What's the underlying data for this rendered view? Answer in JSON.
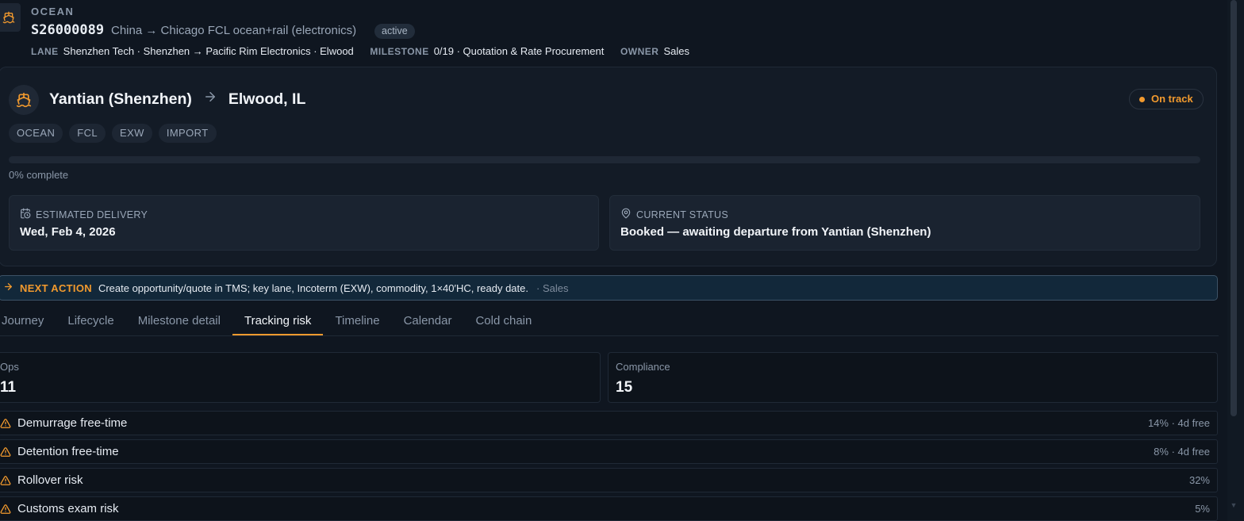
{
  "header": {
    "mode": "OCEAN",
    "shipment_id": "S26000089",
    "description": "China → Chicago FCL ocean+rail (electronics)",
    "status_badge": "active",
    "lane_label": "LANE",
    "lane_value": "Shenzhen Tech · Shenzhen → Pacific Rim Electronics · Elwood",
    "milestone_label": "MILESTONE",
    "milestone_value": "0/19 · Quotation & Rate Procurement",
    "owner_label": "OWNER",
    "owner_value": "Sales",
    "icon": "ship-icon"
  },
  "route": {
    "origin": "Yantian (Shenzhen)",
    "destination": "Elwood, IL",
    "status": "On track",
    "status_color": "#f29a2e",
    "tags": [
      "OCEAN",
      "FCL",
      "EXW",
      "IMPORT"
    ],
    "progress_fraction": 0,
    "progress_text": "0% complete",
    "estimated_delivery_label": "ESTIMATED DELIVERY",
    "estimated_delivery_value": "Wed, Feb 4, 2026",
    "current_status_label": "CURRENT STATUS",
    "current_status_value": "Booked — awaiting departure from Yantian (Shenzhen)"
  },
  "next_action": {
    "label": "NEXT ACTION",
    "text": "Create opportunity/quote in TMS; key lane, Incoterm (EXW), commodity, 1×40′HC, ready date.",
    "owner": "· Sales"
  },
  "tabs": [
    {
      "label": "Journey",
      "active": false
    },
    {
      "label": "Lifecycle",
      "active": false
    },
    {
      "label": "Milestone detail",
      "active": false
    },
    {
      "label": "Tracking risk",
      "active": true
    },
    {
      "label": "Timeline",
      "active": false
    },
    {
      "label": "Calendar",
      "active": false
    },
    {
      "label": "Cold chain",
      "active": false
    }
  ],
  "stats": {
    "ops_label": "Ops",
    "ops_value": "11",
    "compliance_label": "Compliance",
    "compliance_value": "15"
  },
  "risks": [
    {
      "name": "Demurrage free-time",
      "value": "14% · 4d free"
    },
    {
      "name": "Detention free-time",
      "value": "8% · 4d free"
    },
    {
      "name": "Rollover risk",
      "value": "32%"
    },
    {
      "name": "Customs exam risk",
      "value": "5%"
    }
  ],
  "colors": {
    "accent": "#f29a2e",
    "background": "#0f1620"
  }
}
